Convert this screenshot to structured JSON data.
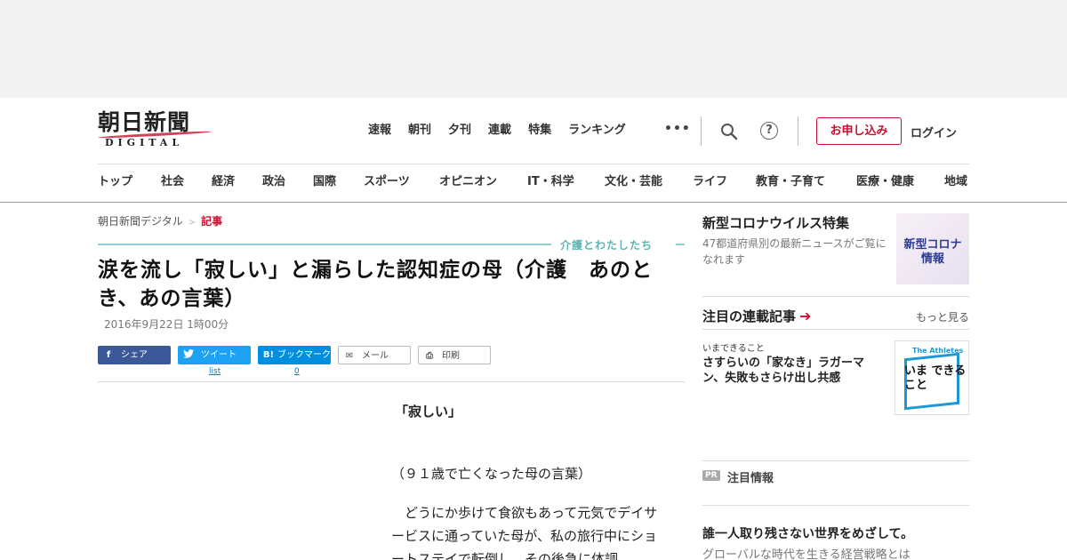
{
  "header": {
    "logo_main": "朝日新聞",
    "logo_sub": "DIGITAL",
    "top_nav": [
      "速報",
      "朝刊",
      "夕刊",
      "連載",
      "特集",
      "ランキング"
    ],
    "more": "•••",
    "help": "?",
    "apply_label": "お申し込み",
    "login_label": "ログイン",
    "category_nav": [
      "トップ",
      "社会",
      "経済",
      "政治",
      "国際",
      "スポーツ",
      "オピニオン",
      "IT・科学",
      "文化・芸能",
      "ライフ",
      "教育・子育て",
      "医療・健康",
      "地域"
    ]
  },
  "breadcrumb": {
    "home": "朝日新聞デジタル",
    "separator": ">",
    "current": "記事"
  },
  "article": {
    "series": "介護とわたしたち",
    "title": "涙を流し「寂しい」と漏らした認知症の母（介護　あのとき、あの言葉）",
    "date": "2016年9月22日 1時00分",
    "share": {
      "facebook": "シェア",
      "twitter": "ツイート",
      "twitter_count": "list",
      "hatena": "ブックマーク",
      "hatena_count": "0",
      "mail": "メール",
      "print": "印刷"
    },
    "body": {
      "quote": "「寂しい」",
      "caption": "（９１歳で亡くなった母の言葉）",
      "para": "　どうにか歩けて食欲もあって元気でデイサービスに通っていた母が、私の旅行中にショートステイで転倒し、その後急に体調"
    }
  },
  "sidebar": {
    "corona": {
      "title": "新型コロナウイルス特集",
      "desc": "47都道府県別の最新ニュースがご覧になれます",
      "image_text": "新型コロナ 情報"
    },
    "rensai": {
      "heading": "注目の連載記事",
      "more": "もっと見る",
      "kicker": "いまできること",
      "headline": "さすらいの「家なき」ラガーマン、失敗もさらけ出し共感",
      "image_tag": "The Athletes",
      "image_text": "いま できること"
    },
    "pr": {
      "badge": "PR",
      "label": "注目情報",
      "title": "誰一人取り残さない世界をめざして。",
      "desc": "グローバルな時代を生きる経営戦略とは"
    }
  }
}
